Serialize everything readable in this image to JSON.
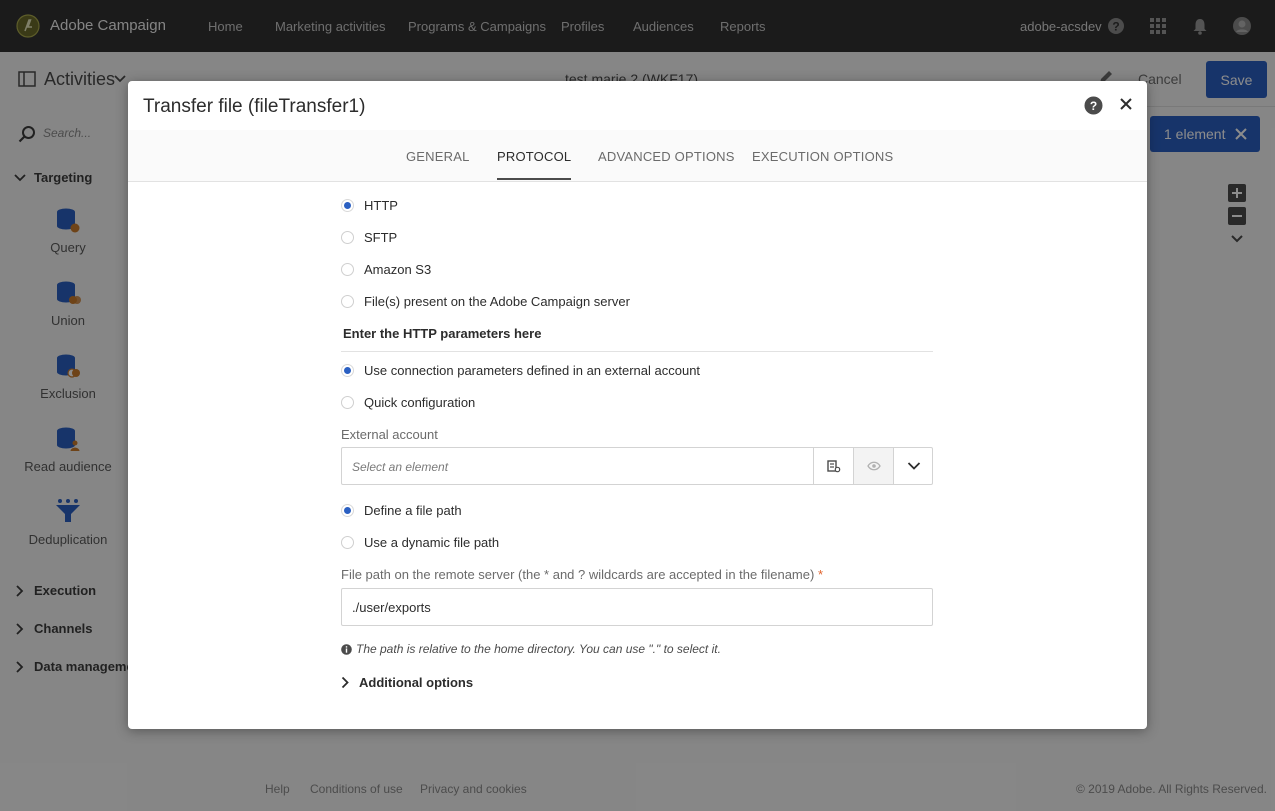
{
  "app": {
    "name": "Adobe Campaign",
    "nav": [
      "Home",
      "Marketing activities",
      "Programs & Campaigns",
      "Profiles",
      "Audiences",
      "Reports"
    ],
    "user": "adobe-acsdev"
  },
  "header": {
    "activities_label": "Activities",
    "workflow_title": "test marie 2 (WKF17)",
    "cancel_label": "Cancel",
    "save_label": "Save"
  },
  "sidebar": {
    "search_placeholder": "Search...",
    "sections": {
      "targeting": "Targeting",
      "execution": "Execution",
      "channels": "Channels",
      "data_management": "Data managemen"
    },
    "tiles": [
      "Query",
      "Union",
      "Exclusion",
      "Read audience",
      "Deduplication"
    ]
  },
  "canvas": {
    "selection_chip": "1 element"
  },
  "footer": {
    "help": "Help",
    "conditions": "Conditions of use",
    "privacy": "Privacy and cookies",
    "copyright": "© 2019 Adobe. All Rights Reserved."
  },
  "dialog": {
    "title": "Transfer file (fileTransfer1)",
    "tabs": [
      "GENERAL",
      "PROTOCOL",
      "ADVANCED OPTIONS",
      "EXECUTION OPTIONS"
    ],
    "active_tab": "PROTOCOL",
    "protocols": [
      {
        "label": "HTTP",
        "selected": true
      },
      {
        "label": "SFTP",
        "selected": false
      },
      {
        "label": "Amazon S3",
        "selected": false
      },
      {
        "label": "File(s) present on the Adobe Campaign server",
        "selected": false
      }
    ],
    "http_section_title": "Enter the HTTP parameters here",
    "connection_options": [
      {
        "label": "Use connection parameters defined in an external account",
        "selected": true
      },
      {
        "label": "Quick configuration",
        "selected": false
      }
    ],
    "external_account_label": "External account",
    "external_account_placeholder": "Select an element",
    "path_options": [
      {
        "label": "Define a file path",
        "selected": true
      },
      {
        "label": "Use a dynamic file path",
        "selected": false
      }
    ],
    "file_path_label": "File path on the remote server (the * and ? wildcards are accepted in the filename)",
    "required_mark": "*",
    "file_path_value": "./user/exports",
    "hint": "The path is relative to the home directory. You can use \".\" to select it.",
    "additional_options": "Additional options"
  },
  "colors": {
    "accent": "#2b60c2",
    "topbar": "#323232",
    "required": "#e0632d"
  }
}
